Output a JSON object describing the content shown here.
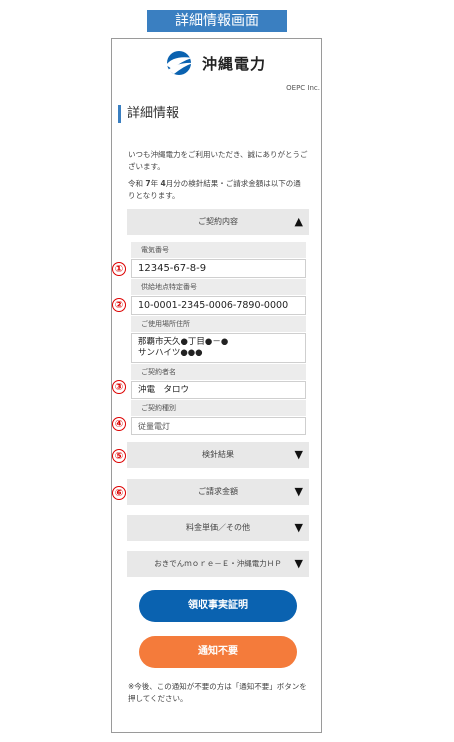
{
  "page_label": "詳細情報画面",
  "header": {
    "logo_text": "沖縄電力",
    "logo_sub": "OEPC Inc."
  },
  "section_title": "詳細情報",
  "intro": {
    "line1": "いつも沖縄電力をご利用いただき、誠にありがとうございます。",
    "line2_pre": "令和",
    "line2_num1": "7",
    "line2_mid": "年",
    "line2_num2": "4",
    "line2_post": "月分の検針結果・ご請求金額は以下の通りとなります。"
  },
  "accordions": {
    "contract": {
      "label": "ご契約内容",
      "icon": "▲"
    },
    "meter": {
      "label": "検針結果",
      "icon": "▼"
    },
    "billing": {
      "label": "ご請求金額",
      "icon": "▼"
    },
    "rates": {
      "label": "料金単価／その他",
      "icon": "▼"
    },
    "more": {
      "label": "おきでんｍｏｒｅ－Ｅ・沖縄電力ＨＰ",
      "icon": "▼"
    }
  },
  "fields": {
    "customer_no": {
      "label": "電気番号",
      "value": "12345-67-8-9"
    },
    "supply_point": {
      "label": "供給地点特定番号",
      "value": "10-0001-2345-0006-7890-0000"
    },
    "address": {
      "label": "ご使用場所住所",
      "value_line1": "那覇市天久●丁目●－●",
      "value_line2": "サンハイツ●●●"
    },
    "contract_name": {
      "label": "ご契約者名",
      "value": "沖電　タロウ"
    },
    "contract_type": {
      "label": "ご契約種別",
      "value": "従量電灯"
    }
  },
  "markers": [
    "①",
    "②",
    "③",
    "④",
    "⑤",
    "⑥"
  ],
  "buttons": {
    "receipt": "領収事実証明",
    "no_notice": "通知不要"
  },
  "note": "※今後、この通知が不要の方は「通知不要」ボタンを押してください。",
  "colors": {
    "brand_blue": "#0a62b0",
    "orange": "#f47b3b",
    "marker_red": "#dd0000"
  }
}
